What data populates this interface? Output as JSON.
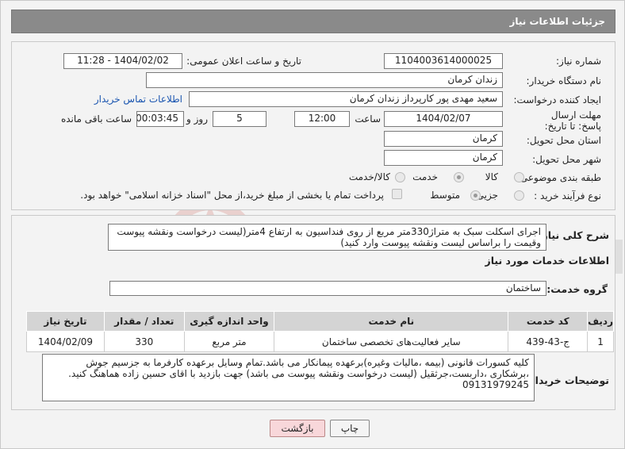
{
  "header": {
    "title": "جزئیات اطلاعات نیاز"
  },
  "fields": {
    "need_number": {
      "label": "شماره نیاز:",
      "value": "1104003614000025"
    },
    "announce_datetime": {
      "label": "تاریخ و ساعت اعلان عمومی:",
      "value": "1404/02/02 - 11:28"
    },
    "buyer_org": {
      "label": "نام دستگاه خریدار:",
      "value": "زندان کرمان"
    },
    "requester": {
      "label": "ایجاد کننده درخواست:",
      "value": "سعید مهدی پور کارپرداز زندان کرمان",
      "contact_link": "اطلاعات تماس خریدار"
    },
    "deadline": {
      "label": "مهلت ارسال پاسخ: تا تاریخ:",
      "date": "1404/02/07",
      "time_label": "ساعت",
      "time": "12:00",
      "days": "5",
      "days_label": "روز و",
      "remaining": "00:03:45",
      "remaining_label": "ساعت باقی مانده"
    },
    "province": {
      "label": "استان محل تحویل:",
      "value": "کرمان"
    },
    "city": {
      "label": "شهر محل تحویل:",
      "value": "کرمان"
    },
    "category": {
      "label": "طبقه بندی موضوعی:",
      "options": [
        "کالا",
        "خدمت",
        "کالا/خدمت"
      ],
      "selected": "خدمت"
    },
    "purchase_type": {
      "label": "نوع فرآیند خرید :",
      "options": [
        "جزیی",
        "متوسط"
      ],
      "selected": "متوسط",
      "payment_note": "پرداخت تمام یا بخشی از مبلغ خرید،از محل \"اسناد خزانه اسلامی\" خواهد بود."
    }
  },
  "description": {
    "label": "شرح کلی نیاز:",
    "text": "اجرای اسکلت سبک به متراژ330متر مربع از روی فنداسیون به ارتفاع 4متر(لیست درخواست ونقشه پیوست وقیمت را براساس لیست ونقشه پیوست وارد کنید)"
  },
  "services": {
    "section_title": "اطلاعات خدمات مورد نیاز",
    "group_label": "گروه خدمت:",
    "group_value": "ساختمان",
    "columns": [
      "ردیف",
      "کد خدمت",
      "نام خدمت",
      "واحد اندازه گیری",
      "تعداد / مقدار",
      "تاریخ نیاز"
    ],
    "rows": [
      [
        "1",
        "ج-43-439",
        "سایر فعالیت‌های تخصصی ساختمان",
        "متر مربع",
        "330",
        "1404/02/09"
      ]
    ]
  },
  "buyer_notes": {
    "label": "توضیحات خریدار:",
    "text": "کلیه کسورات قانونی (بیمه ،مالیات وغیره)برعهده پیمانکار می باشد.تمام وسایل برعهده کارفرما به جزسیم جوش ،برشکاری ،داربست،جرثقیل (لیست درخواست ونقشه پیوست می باشد) جهت بازدید با اقای حسین زاده هماهنگ کنید. 09131979245"
  },
  "buttons": {
    "print": "چاپ",
    "back": "بازگشت"
  },
  "watermark": {
    "text": "AriaTender.neT"
  }
}
